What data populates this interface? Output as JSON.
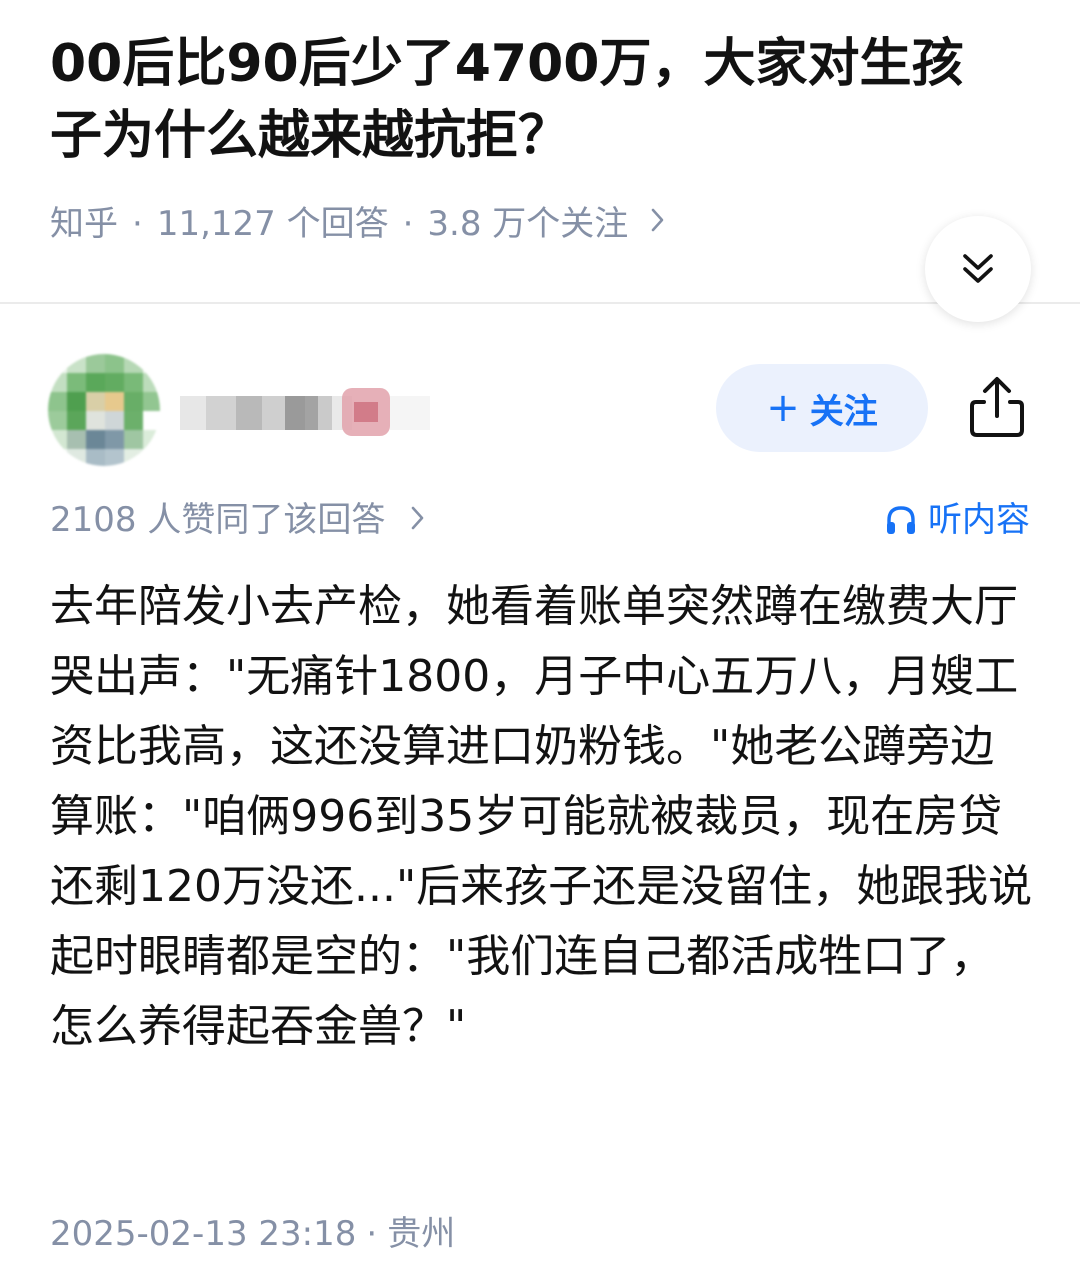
{
  "question": {
    "title": "00后比90后少了4700万，大家对生孩子为什么越来越抗拒？",
    "source": "知乎",
    "answers_count": "11,127 个回答",
    "followers_count": "3.8 万个关注",
    "separator": "·"
  },
  "icons": {
    "expand": "double-chevron-down-icon",
    "share": "share-icon",
    "listen": "headphones-icon",
    "meta_chevron": "chevron-right-icon"
  },
  "colors": {
    "accent": "#1772f6",
    "follow_bg": "#ebf1fd",
    "meta_text": "#8590a6",
    "body_text": "#121212"
  },
  "author": {
    "follow_label": "关注",
    "follow_plus": "+"
  },
  "answer": {
    "votes": "2108 人赞同了该回答",
    "listen_label": "听内容",
    "content": "去年陪发小去产检，她看着账单突然蹲在缴费大厅哭出声：\"无痛针1800，月子中心五万八，月嫂工资比我高，这还没算进口奶粉钱。\"她老公蹲旁边算账：\"咱俩996到35岁可能就被裁员，现在房贷还剩120万没还...\"后来孩子还是没留住，她跟我说起时眼睛都是空的：\"我们连自己都活成牲口了，怎么养得起吞金兽？\"",
    "date": "2025-02-13 23:18",
    "location": "贵州",
    "separator": "·"
  }
}
